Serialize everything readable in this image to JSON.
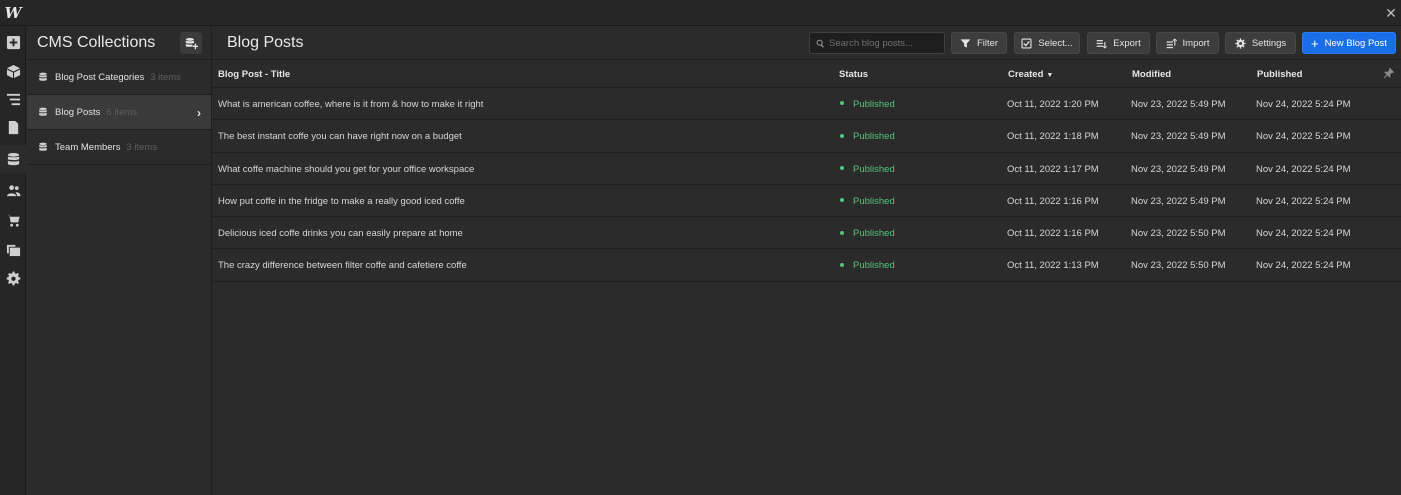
{
  "app": {
    "logo": "W"
  },
  "collections": {
    "title": "CMS Collections",
    "items": [
      {
        "name": "Blog Post Categories",
        "count": "3 items",
        "active": false
      },
      {
        "name": "Blog Posts",
        "count": "6 items",
        "active": true
      },
      {
        "name": "Team Members",
        "count": "3 items",
        "active": false
      }
    ]
  },
  "main": {
    "title": "Blog Posts",
    "search": {
      "placeholder": "Search blog posts..."
    },
    "toolbar": {
      "filter": "Filter",
      "select": "Select...",
      "export": "Export",
      "import": "Import",
      "settings": "Settings",
      "new": "New Blog Post"
    },
    "columns": {
      "title": "Blog Post - Title",
      "status": "Status",
      "created": "Created",
      "modified": "Modified",
      "published": "Published"
    },
    "rows": [
      {
        "title": "What is american coffee, where is it from & how to make it right",
        "status": "Published",
        "created": "Oct 11, 2022 1:20 PM",
        "modified": "Nov 23, 2022 5:49 PM",
        "published": "Nov 24, 2022 5:24 PM"
      },
      {
        "title": "The best instant coffe you can have right now on a budget",
        "status": "Published",
        "created": "Oct 11, 2022 1:18 PM",
        "modified": "Nov 23, 2022 5:49 PM",
        "published": "Nov 24, 2022 5:24 PM"
      },
      {
        "title": "What coffe machine should you get for your office workspace",
        "status": "Published",
        "created": "Oct 11, 2022 1:17 PM",
        "modified": "Nov 23, 2022 5:49 PM",
        "published": "Nov 24, 2022 5:24 PM"
      },
      {
        "title": "How put coffe in the fridge to make a really good iced coffe",
        "status": "Published",
        "created": "Oct 11, 2022 1:16 PM",
        "modified": "Nov 23, 2022 5:49 PM",
        "published": "Nov 24, 2022 5:24 PM"
      },
      {
        "title": "Delicious iced coffe drinks you can easily prepare at home",
        "status": "Published",
        "created": "Oct 11, 2022 1:16 PM",
        "modified": "Nov 23, 2022 5:50 PM",
        "published": "Nov 24, 2022 5:24 PM"
      },
      {
        "title": "The crazy difference between filter coffe and cafetiere coffe",
        "status": "Published",
        "created": "Oct 11, 2022 1:13 PM",
        "modified": "Nov 23, 2022 5:50 PM",
        "published": "Nov 24, 2022 5:24 PM"
      }
    ]
  },
  "colors": {
    "accent": "#1a6ee8",
    "status_published": "#56c27a",
    "background": "#2b2b2b"
  }
}
